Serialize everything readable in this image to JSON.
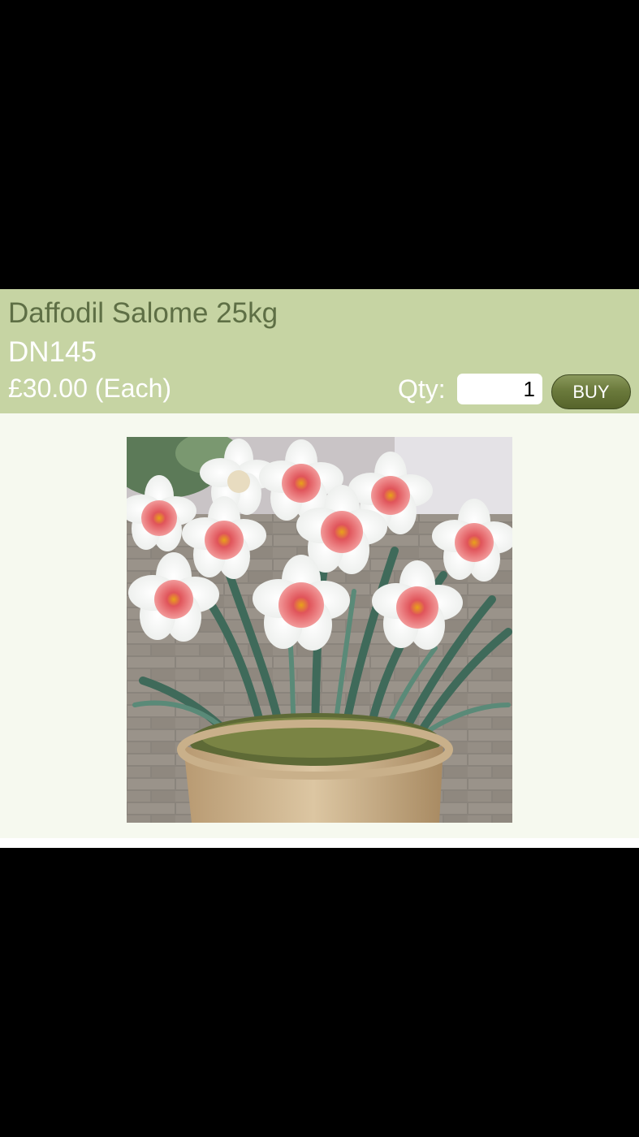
{
  "product": {
    "name": "Daffodil Salome 25kg",
    "code": "DN145",
    "price": "£30.00 (Each)"
  },
  "purchase": {
    "qty_label": "Qty:",
    "qty_value": "1",
    "buy_label": "BUY"
  },
  "image": {
    "subject": "white daffodils with pink cups in terracotta pot"
  },
  "colors": {
    "header_bg": "#c6d4a3",
    "name_text": "#5e6f45",
    "buy_button": "#6b7a3c",
    "content_bg": "#f6f9ef"
  }
}
